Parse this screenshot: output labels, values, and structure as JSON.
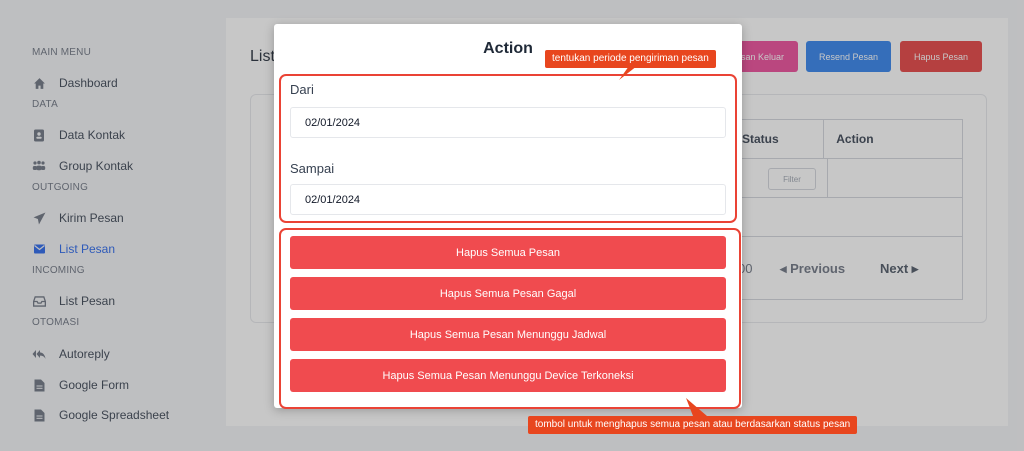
{
  "sidebar": {
    "sections": [
      {
        "title": "MAIN MENU",
        "items": [
          {
            "label": "Dashboard",
            "icon": "home-icon"
          }
        ]
      },
      {
        "title": "DATA",
        "items": [
          {
            "label": "Data Kontak",
            "icon": "contact-card-icon"
          },
          {
            "label": "Group Kontak",
            "icon": "users-icon"
          }
        ]
      },
      {
        "title": "OUTGOING",
        "items": [
          {
            "label": "Kirim Pesan",
            "icon": "send-icon"
          },
          {
            "label": "List Pesan",
            "icon": "envelope-icon"
          }
        ]
      },
      {
        "title": "INCOMING",
        "items": [
          {
            "label": "List Pesan",
            "icon": "inbox-icon"
          }
        ]
      },
      {
        "title": "OTOMASI",
        "items": [
          {
            "label": "Autoreply",
            "icon": "reply-all-icon"
          },
          {
            "label": "Google Form",
            "icon": "file-icon"
          },
          {
            "label": "Google Spreadsheet",
            "icon": "file-icon"
          }
        ]
      }
    ],
    "active_color": "#2563eb"
  },
  "main": {
    "title": "List",
    "header_buttons": [
      {
        "label": "san Keluar",
        "color": "#ec4899"
      },
      {
        "label": "Resend Pesan",
        "color": "#2f80ed"
      },
      {
        "label": "Hapus Pesan",
        "color": "#e53e3e"
      }
    ],
    "table": {
      "columns": [
        "Status",
        "Action"
      ],
      "filter_label": "Filter",
      "pagination": {
        "page_size_fragment": "00",
        "previous": "◂  Previous",
        "next": "Next  ▸"
      }
    }
  },
  "modal": {
    "title": "Action",
    "from_label": "Dari",
    "from_value": "02/01/2024",
    "to_label": "Sampai",
    "to_value": "02/01/2024",
    "buttons": [
      "Hapus Semua Pesan",
      "Hapus Semua Pesan Gagal",
      "Hapus Semua Pesan Menunggu Jadwal",
      "Hapus Semua Pesan Menunggu Device Terkoneksi"
    ],
    "button_color": "#f04b4f"
  },
  "annotations": {
    "period_note": "tentukan periode pengiriman pesan",
    "delete_note": "tombol untuk menghapus semua pesan atau berdasarkan status pesan",
    "color": "#e8461e"
  }
}
